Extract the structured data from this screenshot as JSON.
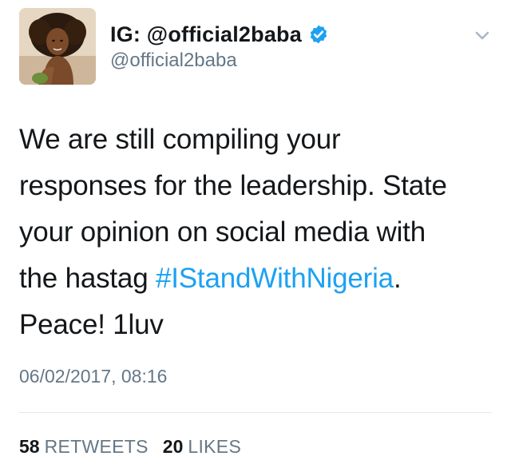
{
  "author": {
    "display_name": "IG: @official2baba",
    "handle": "@official2baba",
    "verified": true,
    "avatar_icon": "profile-photo"
  },
  "tweet": {
    "lines": [
      {
        "text": "We are still compiling your"
      },
      {
        "text": "responses for the leadership. State"
      },
      {
        "text": "your opinion on social media with"
      },
      {
        "before": "the hastag ",
        "hashtag": "#IStandWithNigeria",
        "after": "."
      },
      {
        "text": "Peace! 1luv"
      }
    ],
    "timestamp": "06/02/2017, 08:16"
  },
  "stats": {
    "retweets_count": "58",
    "retweets_label": "RETWEETS",
    "likes_count": "20",
    "likes_label": "LIKES"
  },
  "colors": {
    "link": "#1da1f2",
    "secondary_text": "#657786",
    "primary_text": "#14171a",
    "divider": "#e1e8ed",
    "verified_badge": "#1da1f2"
  },
  "icons": {
    "menu": "chevron-down-icon",
    "verified": "verified-badge-icon"
  }
}
